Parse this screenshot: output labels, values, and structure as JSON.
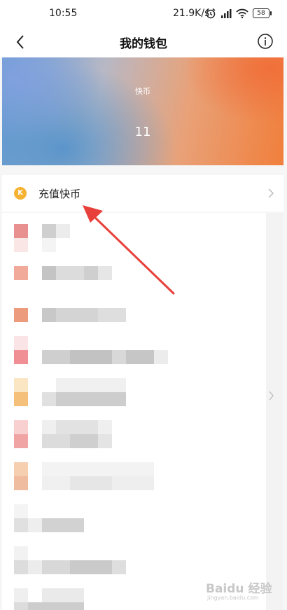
{
  "status_bar": {
    "time": "10:55",
    "network_speed": "21.9K/s",
    "battery": "58"
  },
  "header": {
    "title": "我的钱包"
  },
  "balance_card": {
    "label": "快币",
    "value": "11"
  },
  "recharge_row": {
    "icon_letter": "K",
    "label": "充值快币"
  },
  "watermark": {
    "text": "Baidu 经验",
    "url": "jingyan.baidu.com"
  }
}
